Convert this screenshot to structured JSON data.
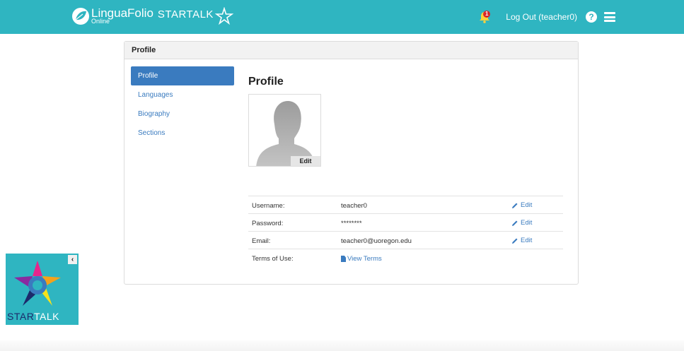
{
  "navbar": {
    "brand_name": "LinguaFolio",
    "brand_sub": "Online",
    "brand_partner": "STARTALK",
    "notification_badge": "1",
    "logout_label": "Log Out (teacher0)",
    "help_label": "?",
    "colors": {
      "bar": "#2fb5c1",
      "badge": "#d9262a"
    }
  },
  "panel": {
    "heading": "Profile"
  },
  "sidenav": {
    "items": [
      {
        "label": "Profile",
        "active": true
      },
      {
        "label": "Languages"
      },
      {
        "label": "Biography"
      },
      {
        "label": "Sections"
      }
    ]
  },
  "profile": {
    "title": "Profile",
    "avatar_edit_label": "Edit",
    "rows": [
      {
        "label": "Username:",
        "value": "teacher0",
        "action": "Edit"
      },
      {
        "label": "Password:",
        "value": "********",
        "action": "Edit"
      },
      {
        "label": "Email:",
        "value": "teacher0@uoregon.edu",
        "action": "Edit"
      },
      {
        "label": "Terms of Use:",
        "link": "View Terms"
      }
    ]
  },
  "widget": {
    "collapse_label": "‹",
    "text_part1": "STAR",
    "text_part2": "TALK"
  },
  "icons": [
    "leaf-icon",
    "star-icon",
    "bell-icon",
    "help-icon",
    "menu-icon",
    "pencil-icon",
    "document-icon",
    "chevron-left-icon"
  ]
}
